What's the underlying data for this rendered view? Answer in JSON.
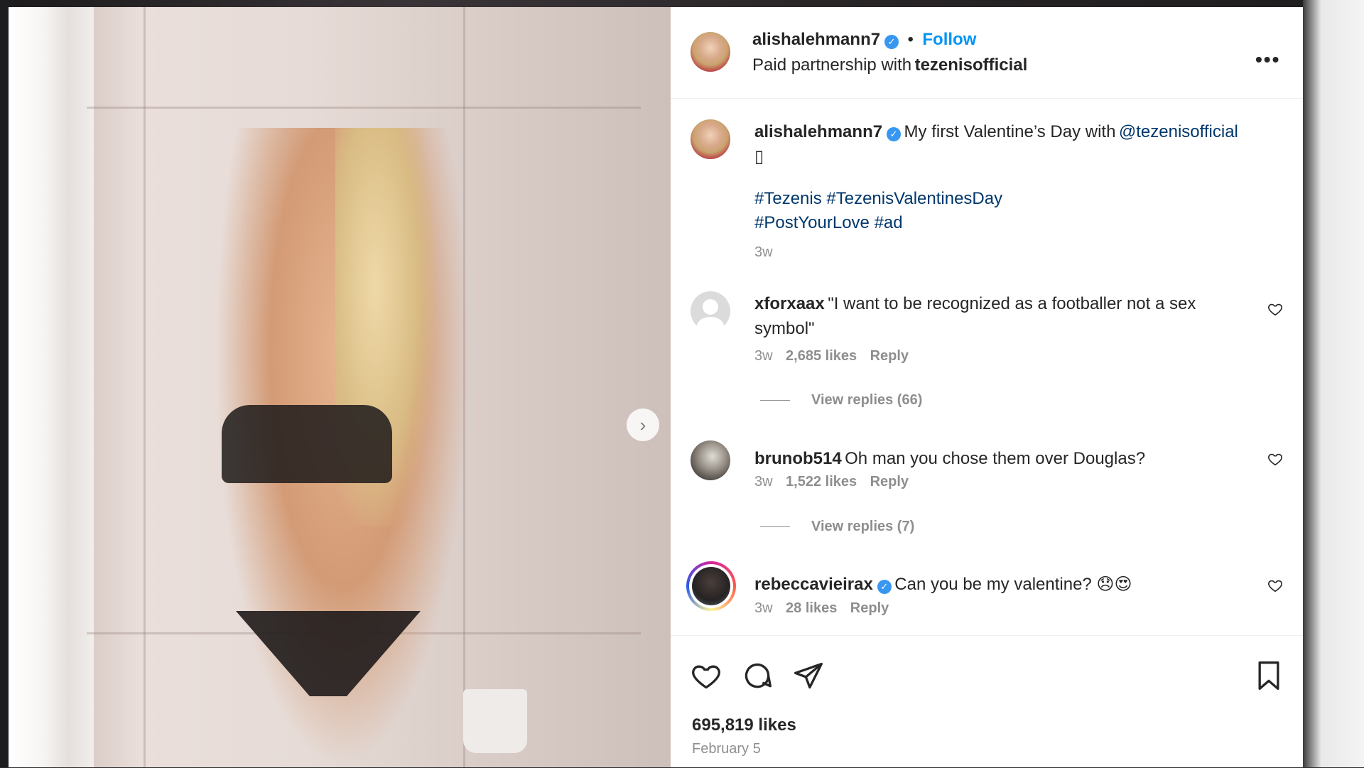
{
  "post": {
    "author": "alishalehmann7",
    "separator": "•",
    "follow_label": "Follow",
    "partnership_prefix": "Paid partnership with",
    "partner": "tezenisofficial",
    "more_label": "•••",
    "caption_text": "My first Valentine’s Day with",
    "caption_mention": "@tezenisofficial",
    "caption_emoji": "▯",
    "hashtags_line1": "#Tezenis #TezenisValentinesDay",
    "hashtags_line2": "#PostYourLove #ad",
    "caption_time": "3w",
    "likes": "695,819 likes",
    "date": "February 5",
    "next_label": "›"
  },
  "comments": [
    {
      "username": "xforxaax",
      "text": "\"I want to be recognized as a footballer not a sex symbol\"",
      "time": "3w",
      "likes": "2,685 likes",
      "reply": "Reply",
      "view_replies": "View replies (66)"
    },
    {
      "username": "brunob514",
      "text": "Oh man you chose them over Douglas?",
      "time": "3w",
      "likes": "1,522 likes",
      "reply": "Reply",
      "view_replies": "View replies (7)"
    },
    {
      "username": "rebeccavieirax",
      "text": "Can you be my valentine? 😞😍",
      "time": "3w",
      "likes": "28 likes",
      "reply": "Reply"
    }
  ],
  "colors": {
    "link": "#00376b",
    "follow_blue": "#0095f6",
    "verified_blue": "#3897f0",
    "muted": "#8e8e8e"
  },
  "icons": [
    "like-icon",
    "comment-icon",
    "share-icon",
    "save-icon",
    "verified-icon",
    "heart-icon",
    "chevron-right-icon",
    "more-icon"
  ]
}
